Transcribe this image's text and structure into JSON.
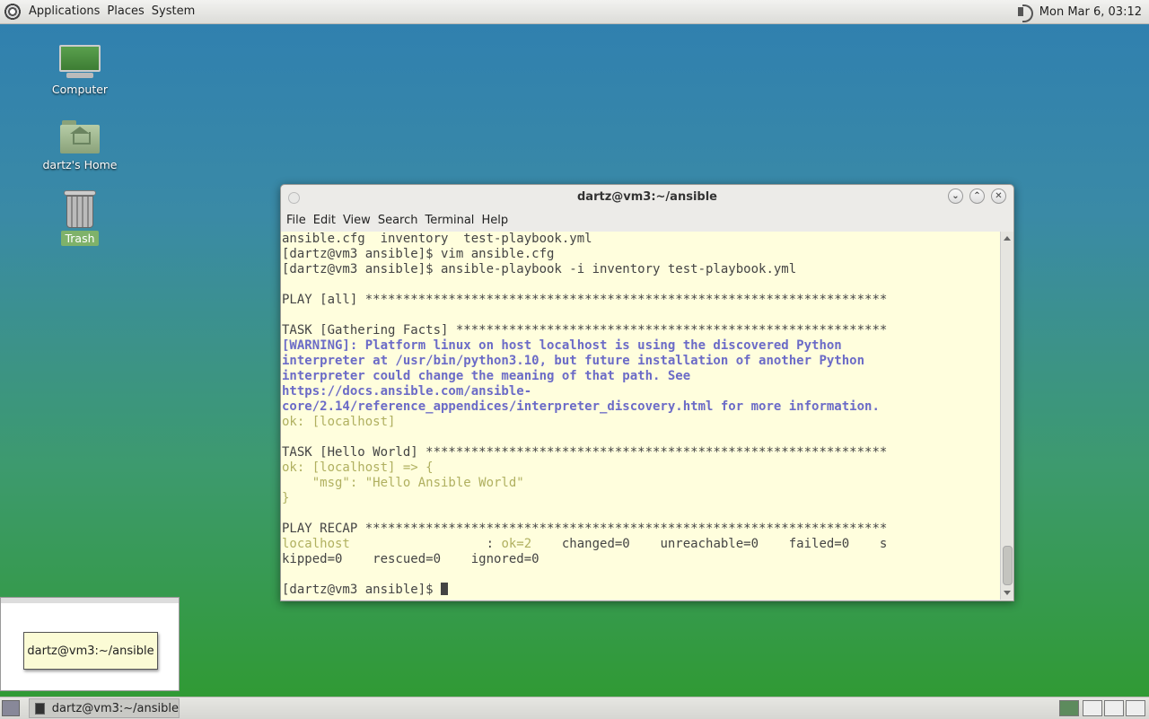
{
  "top_panel": {
    "menus": [
      "Applications",
      "Places",
      "System"
    ],
    "clock": "Mon Mar  6, 03:12"
  },
  "desktop_icons": [
    {
      "label": "Computer",
      "icon": "computer-icon"
    },
    {
      "label": "dartz's Home",
      "icon": "home-folder-icon"
    },
    {
      "label": "Trash",
      "icon": "trash-icon"
    }
  ],
  "terminal_window": {
    "title": "dartz@vm3:~/ansible",
    "menus": [
      "File",
      "Edit",
      "View",
      "Search",
      "Terminal",
      "Help"
    ],
    "lines": [
      {
        "text": "ansible.cfg  inventory  test-playbook.yml",
        "style": ""
      },
      {
        "text": "[dartz@vm3 ansible]$ vim ansible.cfg",
        "style": ""
      },
      {
        "text": "[dartz@vm3 ansible]$ ansible-playbook -i inventory test-playbook.yml",
        "style": ""
      },
      {
        "text": "",
        "style": ""
      },
      {
        "text": "PLAY [all] *********************************************************************",
        "style": ""
      },
      {
        "text": "",
        "style": ""
      },
      {
        "text": "TASK [Gathering Facts] *********************************************************",
        "style": ""
      },
      {
        "text": "[WARNING]: Platform linux on host localhost is using the discovered Python",
        "style": "warn"
      },
      {
        "text": "interpreter at /usr/bin/python3.10, but future installation of another Python",
        "style": "warn"
      },
      {
        "text": "interpreter could change the meaning of that path. See",
        "style": "warn"
      },
      {
        "text": "https://docs.ansible.com/ansible-",
        "style": "warn"
      },
      {
        "text": "core/2.14/reference_appendices/interpreter_discovery.html for more information.",
        "style": "warn"
      },
      {
        "text": "ok: [localhost]",
        "style": "ok"
      },
      {
        "text": "",
        "style": ""
      },
      {
        "text": "TASK [Hello World] *************************************************************",
        "style": ""
      },
      {
        "text": "ok: [localhost] => {",
        "style": "ok"
      },
      {
        "text": "    \"msg\": \"Hello Ansible World\"",
        "style": "ok"
      },
      {
        "text": "}",
        "style": "ok"
      },
      {
        "text": "",
        "style": ""
      },
      {
        "text": "PLAY RECAP *********************************************************************",
        "style": ""
      },
      {
        "text": "localhost                  : ok=2    changed=0    unreachable=0    failed=0    s",
        "style": "recap"
      },
      {
        "text": "kipped=0    rescued=0    ignored=0",
        "style": ""
      },
      {
        "text": "",
        "style": ""
      },
      {
        "text": "[dartz@vm3 ansible]$ ",
        "style": ""
      }
    ]
  },
  "workspace_tooltip": "dartz@vm3:~/ansible",
  "taskbar": {
    "task_label": "dartz@vm3:~/ansible"
  }
}
